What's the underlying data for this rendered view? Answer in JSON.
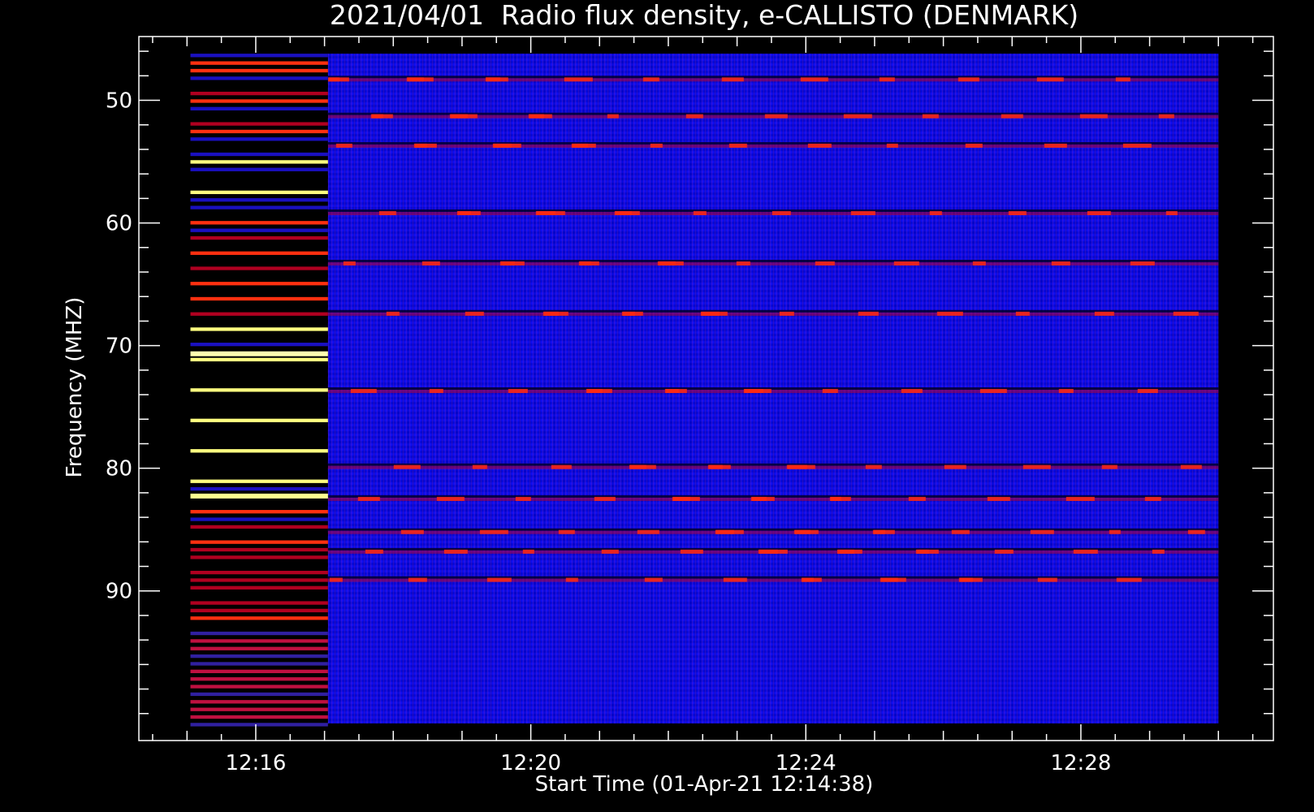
{
  "chart_data": {
    "type": "heatmap",
    "title": "2021/04/01  Radio flux density, e-CALLISTO (DENMARK)",
    "xlabel": "Start Time (01-Apr-21 12:14:38)",
    "ylabel": "Frequency (MHZ)",
    "x_ticks": [
      "12:16",
      "12:20",
      "12:24",
      "12:28"
    ],
    "x_tick_minutes": [
      16,
      20,
      24,
      28
    ],
    "xlim_minutes": [
      14.3,
      30.8
    ],
    "data_x_minutes": [
      15.05,
      30.0
    ],
    "y_ticks": [
      50,
      60,
      70,
      80,
      90
    ],
    "ylim": [
      44.8,
      102.2
    ],
    "data_y_range": [
      46.2,
      100.8
    ],
    "bursts": [
      {
        "t_start": 15.05,
        "t_end": 17.05,
        "f_start": 46.2,
        "f_end": 100.8,
        "level": "intense"
      }
    ],
    "persistent_bands_mhz": [
      48.2,
      51.2,
      53.6,
      59.1,
      63.2,
      67.3,
      73.6,
      79.8,
      82.4,
      85.1,
      86.7,
      89.0
    ],
    "colormap": {
      "low": "#000000",
      "mid_low": "#0000ff",
      "mid": "#ff0000",
      "high": "#ffff66"
    },
    "grid": false,
    "legend": "none"
  }
}
